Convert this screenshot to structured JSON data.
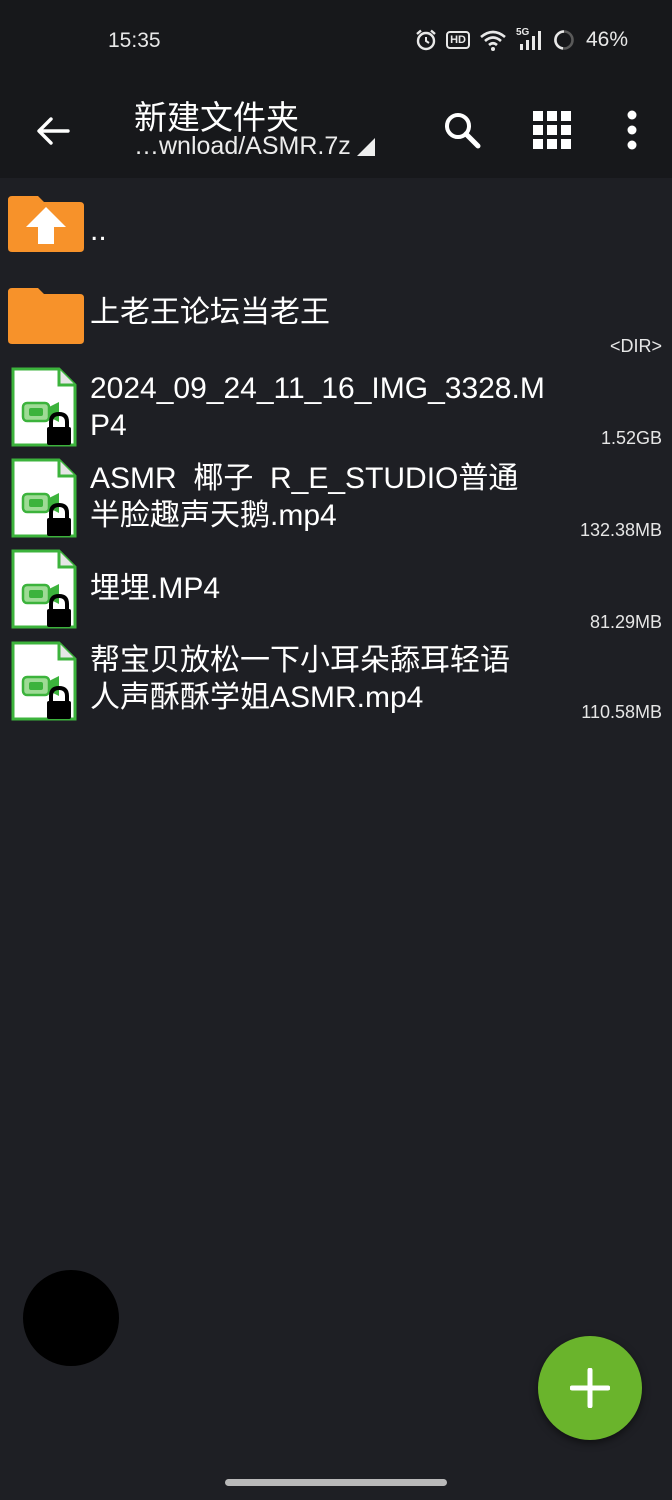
{
  "status_bar": {
    "time": "15:35",
    "hd_badge": "HD",
    "network": "5G",
    "battery_percent": "46%",
    "icons": [
      "alarm-icon",
      "hd-icon",
      "wifi-icon",
      "signal-icon",
      "battery-ring-icon"
    ]
  },
  "toolbar": {
    "title": "新建文件夹",
    "path": "…wnload/ASMR.7z",
    "icons": [
      "back-arrow-icon",
      "search-icon",
      "grid-view-icon",
      "more-vert-icon"
    ]
  },
  "files": [
    {
      "name": "..",
      "type": "parent",
      "size": ""
    },
    {
      "name": "上老王论坛当老王",
      "type": "folder",
      "size": "<DIR>"
    },
    {
      "name_lines": [
        "2024_09_24_11_16_IMG_3328.M",
        "P4"
      ],
      "type": "video-locked",
      "size": "1.52GB"
    },
    {
      "name_lines": [
        "ASMR  椰子  R_E_STUDIO普通",
        "半脸趣声天鹅.mp4"
      ],
      "type": "video-locked",
      "size": "132.38MB"
    },
    {
      "name": "埋埋.MP4",
      "type": "video-locked",
      "size": "81.29MB"
    },
    {
      "name_lines": [
        "帮宝贝放松一下小耳朵舔耳轻语",
        "人声酥酥学姐ASMR.mp4"
      ],
      "type": "video-locked",
      "size": "110.58MB"
    }
  ],
  "colors": {
    "background": "#1e1f24",
    "bar": "#17181b",
    "folder": "#f7922a",
    "file_icon_green": "#3cb33c",
    "fab": "#6ab42c"
  },
  "fab": {
    "icon": "plus-icon"
  }
}
